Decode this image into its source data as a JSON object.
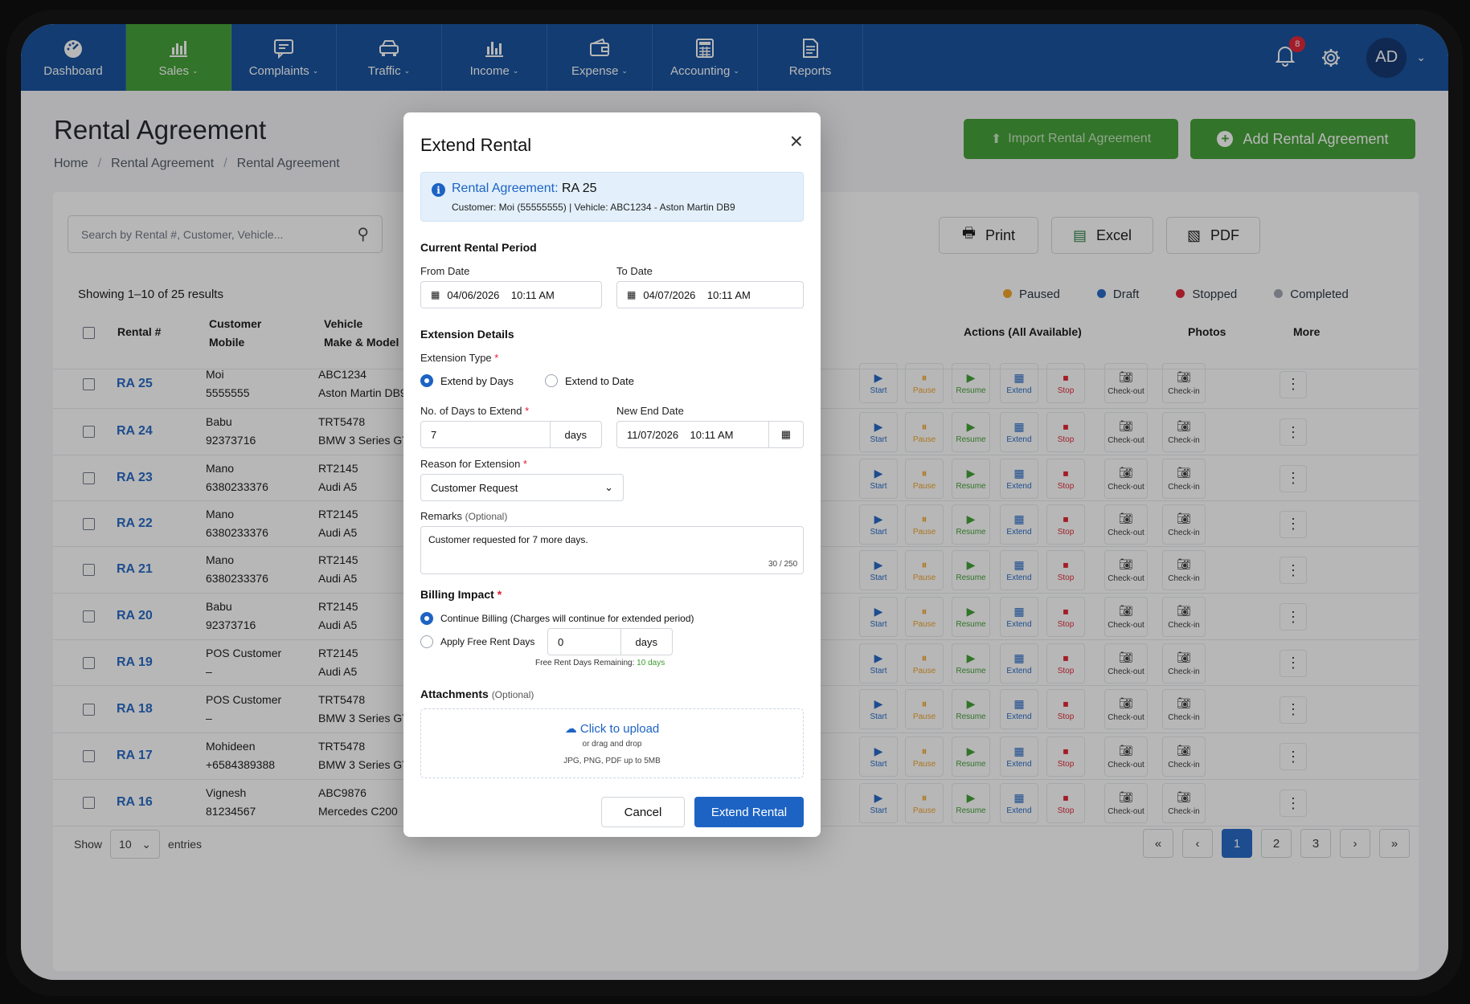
{
  "nav": {
    "items": [
      {
        "label": "Dashboard",
        "icon": "dashboard-icon",
        "dropdown": false
      },
      {
        "label": "Sales",
        "icon": "bar-chart-icon",
        "dropdown": true
      },
      {
        "label": "Complaints",
        "icon": "complaint-icon",
        "dropdown": true
      },
      {
        "label": "Traffic",
        "icon": "car-icon",
        "dropdown": true
      },
      {
        "label": "Income",
        "icon": "income-chart-icon",
        "dropdown": true
      },
      {
        "label": "Expense",
        "icon": "wallet-icon",
        "dropdown": true
      },
      {
        "label": "Accounting",
        "icon": "calculator-icon",
        "dropdown": true
      },
      {
        "label": "Reports",
        "icon": "report-icon",
        "dropdown": false
      }
    ],
    "active": "Sales",
    "notification_count": "8",
    "avatar": "AD"
  },
  "page": {
    "title": "Rental Agreement",
    "breadcrumb": [
      "Home",
      "Rental Agreement",
      "Rental Agreement"
    ],
    "import_label": "Import Rental Agreement",
    "add_label": "Add Rental Agreement",
    "search_placeholder": "Search by Rental #, Customer, Vehicle...",
    "print": "Print",
    "excel": "Excel",
    "pdf": "PDF",
    "showing": "Showing 1–10 of 25 results",
    "legend": [
      {
        "label": "Paused",
        "color": "#f0a020"
      },
      {
        "label": "Draft",
        "color": "#1d63c4"
      },
      {
        "label": "Stopped",
        "color": "#e11d2f"
      },
      {
        "label": "Completed",
        "color": "#9ca3af"
      }
    ]
  },
  "table": {
    "headers": {
      "rental": "Rental #",
      "customer_1": "Customer",
      "customer_2": "Mobile",
      "vehicle_1": "Vehicle",
      "vehicle_2": "Make & Model",
      "actions": "Actions (All Available)",
      "photos": "Photos",
      "more": "More"
    },
    "action_labels": [
      "Start",
      "Pause",
      "Resume",
      "Extend",
      "Stop"
    ],
    "photo_labels": [
      "Check-out",
      "Check-in"
    ],
    "rows": [
      {
        "id": "RA 25",
        "customer": "Moi",
        "mobile": "5555555",
        "plate": "ABC1234",
        "model": "Aston Martin DB9"
      },
      {
        "id": "RA 24",
        "customer": "Babu",
        "mobile": "92373716",
        "plate": "TRT5478",
        "model": "BMW 3 Series GT"
      },
      {
        "id": "RA 23",
        "customer": "Mano",
        "mobile": "6380233376",
        "plate": "RT2145",
        "model": "Audi A5"
      },
      {
        "id": "RA 22",
        "customer": "Mano",
        "mobile": "6380233376",
        "plate": "RT2145",
        "model": "Audi A5"
      },
      {
        "id": "RA 21",
        "customer": "Mano",
        "mobile": "6380233376",
        "plate": "RT2145",
        "model": "Audi A5"
      },
      {
        "id": "RA 20",
        "customer": "Babu",
        "mobile": "92373716",
        "plate": "RT2145",
        "model": "Audi A5"
      },
      {
        "id": "RA 19",
        "customer": "POS Customer",
        "mobile": "–",
        "plate": "RT2145",
        "model": "Audi A5"
      },
      {
        "id": "RA 18",
        "customer": "POS Customer",
        "mobile": "–",
        "plate": "TRT5478",
        "model": "BMW 3 Series GT"
      },
      {
        "id": "RA 17",
        "customer": "Mohideen",
        "mobile": "+6584389388",
        "plate": "TRT5478",
        "model": "BMW 3 Series GT"
      },
      {
        "id": "RA 16",
        "customer": "Vignesh",
        "mobile": "81234567",
        "plate": "ABC9876",
        "model": "Mercedes C200"
      }
    ]
  },
  "footer": {
    "show": "Show",
    "entries_value": "10",
    "entries": "entries",
    "pages": [
      "«",
      "‹",
      "1",
      "2",
      "3",
      "›",
      "»"
    ],
    "current_page": "1"
  },
  "modal": {
    "title": "Extend Rental",
    "info_label": "Rental Agreement:",
    "info_value": "RA 25",
    "info_sub": "Customer: Moi (55555555)  |  Vehicle: ABC1234 - Aston Martin DB9",
    "current_period": "Current Rental Period",
    "from_label": "From Date",
    "from_value": "04/06/2026    10:11 AM",
    "to_label": "To Date",
    "to_value": "04/07/2026    10:11 AM",
    "extension_details": "Extension Details",
    "ext_type_label": "Extension Type",
    "ext_by_days": "Extend by Days",
    "ext_to_date": "Extend to Date",
    "days_label": "No. of Days to Extend",
    "days_value": "7",
    "days_unit": "days",
    "new_end_label": "New End Date",
    "new_end_value": "11/07/2026    10:11 AM",
    "reason_label": "Reason for Extension",
    "reason_value": "Customer Request",
    "remarks_label": "Remarks",
    "optional": "(Optional)",
    "remarks_value": "Customer requested for 7 more days.",
    "remarks_count": "30 / 250",
    "billing_label": "Billing Impact",
    "billing_continue": "Continue Billing (Charges will continue for extended period)",
    "billing_free": "Apply Free Rent Days",
    "free_days_value": "0",
    "free_days_unit": "days",
    "free_remaining_label": "Free Rent Days Remaining:",
    "free_remaining_value": "10 days",
    "attachments_label": "Attachments",
    "upload_title": "Click to upload",
    "upload_sub": "or drag and drop",
    "upload_types": "JPG, PNG, PDF up to 5MB",
    "cancel": "Cancel",
    "submit": "Extend Rental"
  },
  "colors": {
    "nav": "#0d4a9a",
    "green": "#3b9c2e",
    "primary": "#1d63c4"
  }
}
